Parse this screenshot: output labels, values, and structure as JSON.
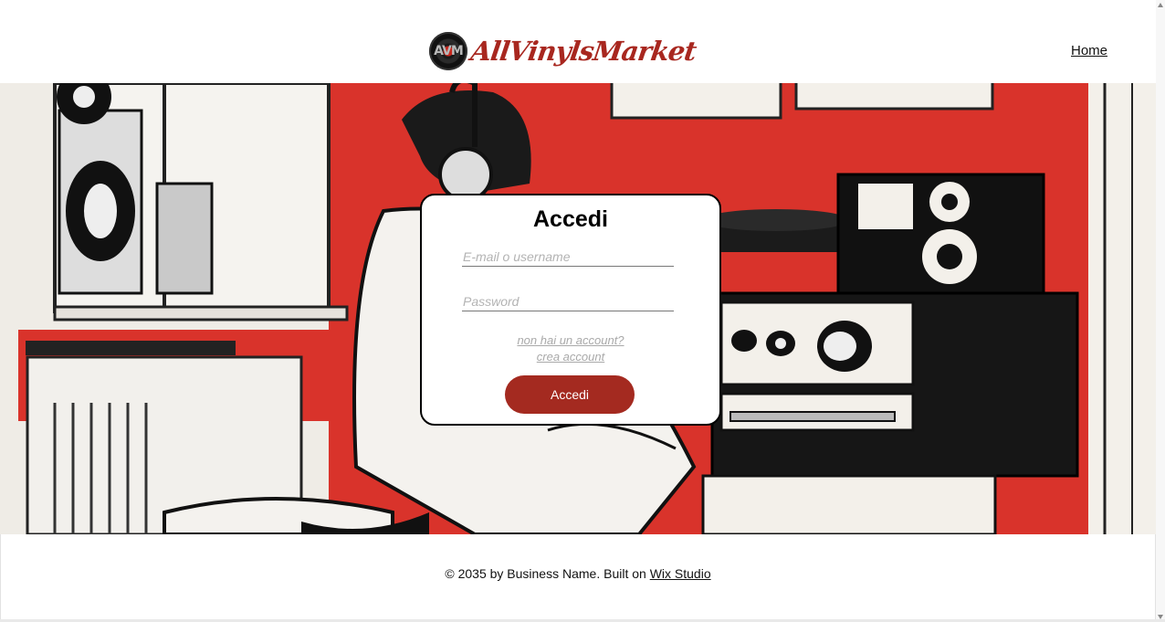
{
  "header": {
    "logo_mark": "AVM",
    "logo_text": "AllVinylsMarket",
    "nav_home": "Home"
  },
  "login": {
    "title": "Accedi",
    "email_placeholder": "E-mail o username",
    "password_placeholder": "Password",
    "no_account": "non hai un account?",
    "create_account": "crea account",
    "submit_label": "Accedi"
  },
  "footer": {
    "copyright": "© 2035 by Business Name. Built on",
    "link": "Wix Studio"
  },
  "colors": {
    "accent": "#a42a20",
    "wall_red": "#d9332b",
    "text": "#111111"
  },
  "icons": {
    "logo": "vinyl-record-icon",
    "scroll_up": "chevron-up-icon",
    "scroll_down": "chevron-down-icon"
  }
}
